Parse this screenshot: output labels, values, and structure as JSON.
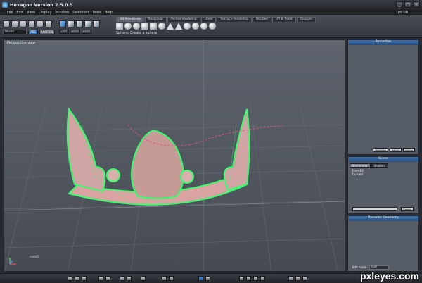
{
  "window": {
    "title": "Hexagon Version 2.5.0.5",
    "minimize": "_",
    "maximize": "□",
    "close": "×"
  },
  "menu": [
    "File",
    "Edit",
    "View",
    "Display",
    "Window",
    "Selection",
    "Tools",
    "Help"
  ],
  "clock": "05:00",
  "toolbar": {
    "coordinate_system": "World",
    "chips": [
      "ABS",
      "UNIFIED"
    ],
    "view_buttons": [
      "LEFT",
      "FRONT",
      "RIGHT"
    ],
    "tabs": [
      "3D Primitives",
      "Sketchup",
      "Vertex modeling",
      "Lines",
      "Surface modeling",
      "Utilities",
      "UV & Paint",
      "Custom"
    ],
    "active_tab": "3D Primitives",
    "hint": "Sphere: Create a sphere"
  },
  "viewport": {
    "label": "Perspective view",
    "camera": "cam01"
  },
  "panels": {
    "properties": {
      "title": "Properties",
      "buttons": [
        "Validate",
        "Abort",
        "Apply"
      ]
    },
    "scene": {
      "title": "Scene",
      "tabs": [
        "Scene tree",
        "Shaders"
      ],
      "items": [
        "Form10",
        "Curve4"
      ],
      "select_button": "Select"
    },
    "dynamic_geometry": {
      "title": "Dynamic Geometry",
      "edit_mode_label": "Edit mode",
      "edit_mode_value": "Soft"
    }
  },
  "watermark": "pxleyes.com",
  "colors": {
    "accent": "#2f6db8",
    "mesh": "#35ff6a",
    "curve": "#e0508a"
  }
}
